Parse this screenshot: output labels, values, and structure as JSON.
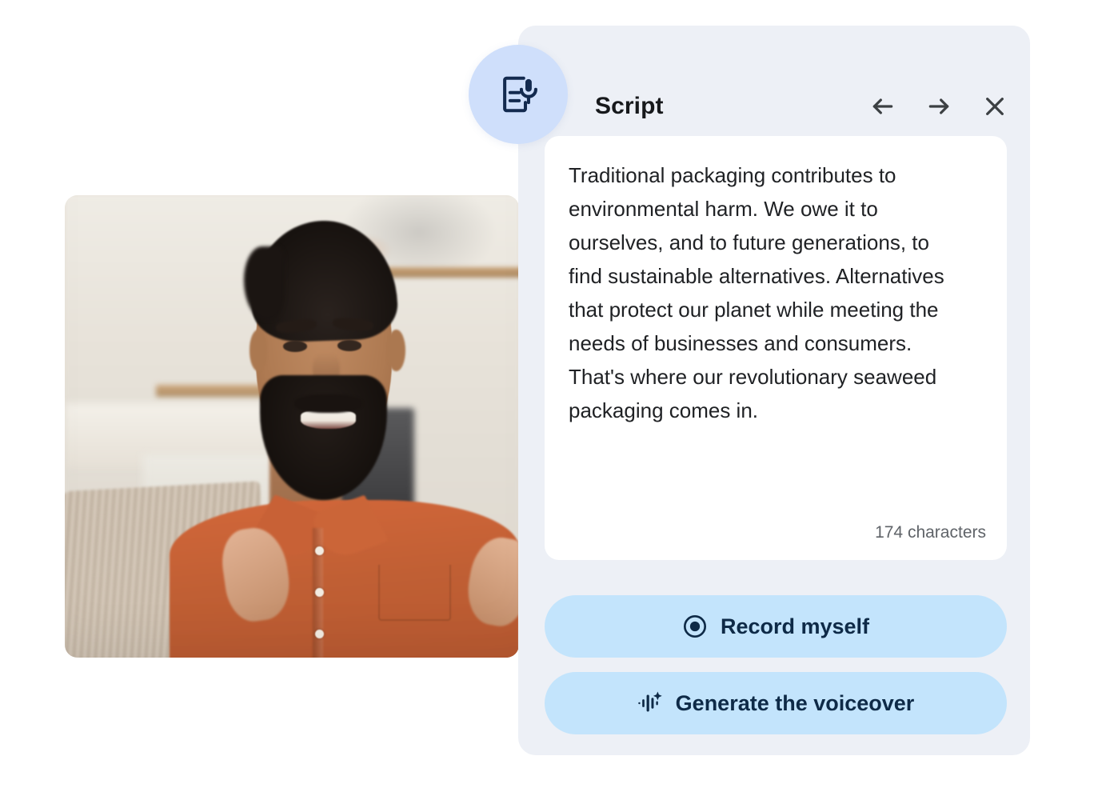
{
  "panel": {
    "title": "Script",
    "badge_icon": "document-microphone-icon",
    "nav": [
      {
        "name": "back-button",
        "icon": "arrow-left-icon",
        "label": "←"
      },
      {
        "name": "forward-button",
        "icon": "arrow-right-icon",
        "label": "→"
      },
      {
        "name": "close-button",
        "icon": "close-icon",
        "label": "×"
      }
    ],
    "script": {
      "text": "Traditional packaging contributes to environmental harm. We owe it to ourselves, and to future generations, to find sustainable alternatives. Alternatives that protect our planet while meeting the needs of businesses and consumers. That's where our revolutionary seaweed packaging comes in.",
      "char_count_label": "174 characters"
    },
    "actions": {
      "record": {
        "label": "Record myself",
        "icon": "record-circle-icon"
      },
      "generate": {
        "label": "Generate the voiceover",
        "icon": "ai-waveform-sparkle-icon"
      }
    }
  },
  "video": {
    "name": "video-preview",
    "alt": "Smiling bearded man in an orange shirt gesturing while speaking on a couch in a kitchen"
  },
  "colors": {
    "panel_bg": "#edf0f6",
    "card_bg": "#ffffff",
    "badge_bg": "#cfdffb",
    "icon_navy": "#132a4f",
    "button_bg": "#c3e4fc",
    "button_text": "#0e2a47",
    "title_text": "#17191c",
    "script_text": "#1f2124",
    "meta_text": "#5f6368",
    "shirt": "#c05f34"
  }
}
